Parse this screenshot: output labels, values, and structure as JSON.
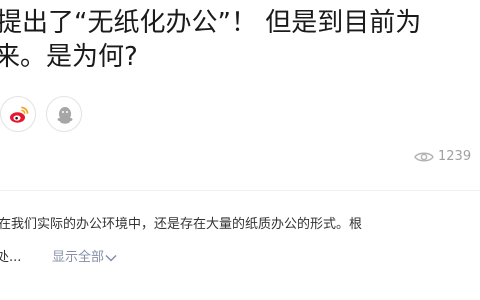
{
  "question": {
    "title_line1": "提出了“无纸化办公”！ 但是到目前为",
    "title_line2": "来。是为何?"
  },
  "share": {
    "icons": [
      "weibo-icon",
      "qq-icon"
    ]
  },
  "stats": {
    "views": "1239"
  },
  "answer": {
    "excerpt": "在我们实际的办公环境中，还是存在大量的纸质办公的形式。根",
    "excerpt_tail": "处...",
    "show_all_label": "显示全部"
  },
  "colors": {
    "link": "#8590a6",
    "muted": "#a0a0a0",
    "weibo_red": "#e6162d",
    "qq_gray": "#a6a6a6"
  }
}
